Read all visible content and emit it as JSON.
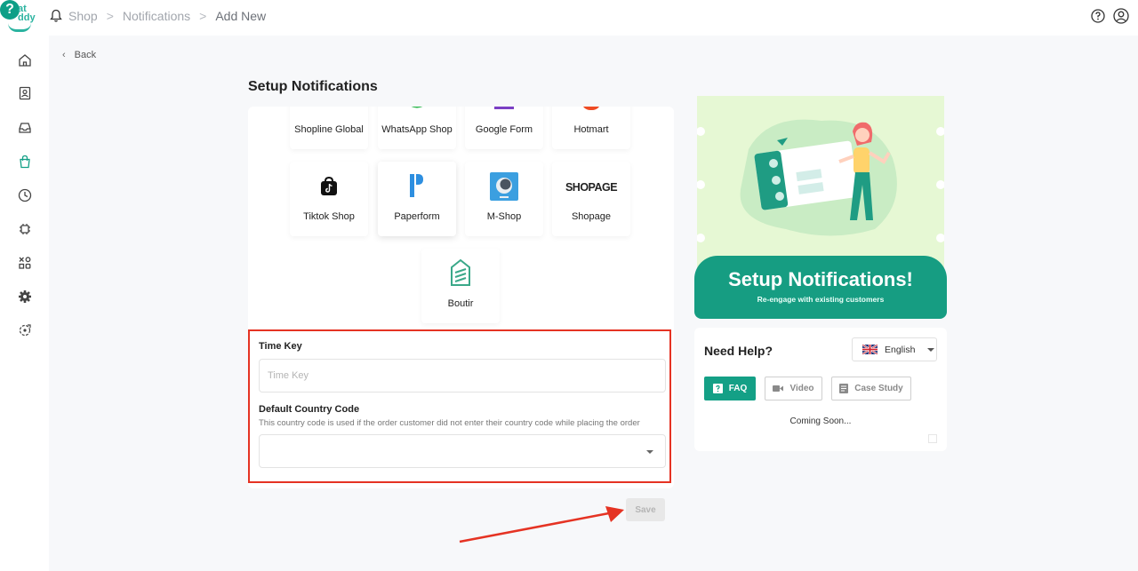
{
  "brand": {
    "logo_text": "at\nddy",
    "logo_glyph": "?"
  },
  "breadcrumb": {
    "items": [
      "Shop",
      "Notifications",
      "Add New"
    ],
    "separator": ">"
  },
  "back_label": "Back",
  "page_title": "Setup Notifications",
  "integrations": [
    {
      "label": "Shopline Global",
      "icon": "shopline-icon"
    },
    {
      "label": "WhatsApp Shop",
      "icon": "whatsapp-icon"
    },
    {
      "label": "Google Form",
      "icon": "google-form-icon"
    },
    {
      "label": "Hotmart",
      "icon": "hotmart-icon"
    },
    {
      "label": "Tiktok Shop",
      "icon": "tiktok-shop-icon"
    },
    {
      "label": "Paperform",
      "icon": "paperform-icon",
      "selected": true
    },
    {
      "label": "M-Shop",
      "icon": "m-shop-icon"
    },
    {
      "label": "Shopage",
      "icon": "shopage-logo",
      "logo_text": "SHOPAGE"
    },
    {
      "label": "Boutir",
      "icon": "boutir-icon"
    }
  ],
  "form": {
    "time_key": {
      "label": "Time Key",
      "placeholder": "Time Key",
      "value": ""
    },
    "country_code": {
      "label": "Default Country Code",
      "help": "This country code is used if the order customer did not enter their country code while placing the order",
      "value": ""
    }
  },
  "save_label": "Save",
  "promo": {
    "title": "Setup Notifications!",
    "subtitle": "Re-engage with existing customers"
  },
  "help": {
    "title": "Need Help?",
    "language": "English",
    "tabs": {
      "faq": "FAQ",
      "video": "Video",
      "case_study": "Case Study"
    },
    "status": "Coming Soon..."
  },
  "colors": {
    "accent": "#14a086",
    "highlight_border": "#e53323",
    "promo_bg": "#e6f8d4"
  }
}
